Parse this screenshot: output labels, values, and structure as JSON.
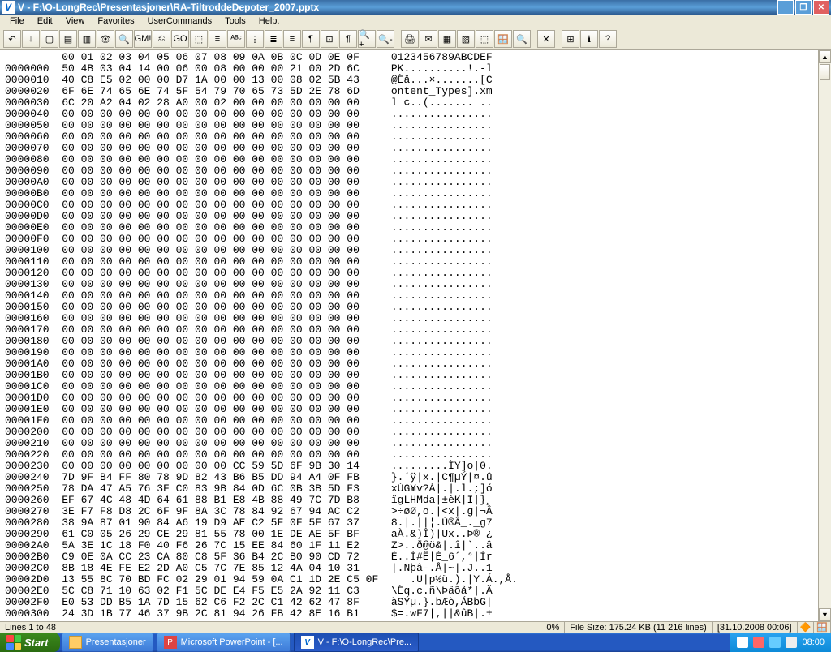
{
  "window": {
    "title": "V - F:\\O-LongRec\\Presentasjoner\\RA-TiltroddeDepoter_2007.pptx"
  },
  "menu": {
    "items": [
      "File",
      "Edit",
      "View",
      "Favorites",
      "UserCommands",
      "Tools",
      "Help."
    ]
  },
  "hex": {
    "header": "         00 01 02 03 04 05 06 07 08 09 0A 0B 0C 0D 0E 0F     0123456789ABCDEF",
    "lines": [
      "0000000  50 4B 03 04 14 00 06 00 08 00 00 00 21 00 2D 6C     PK..........!.-l",
      "0000010  40 C8 E5 02 00 00 D7 1A 00 00 13 00 08 02 5B 43     @Èå...×.......[C",
      "0000020  6F 6E 74 65 6E 74 5F 54 79 70 65 73 5D 2E 78 6D     ontent_Types].xm",
      "0000030  6C 20 A2 04 02 28 A0 00 02 00 00 00 00 00 00 00     l ¢..(....... ..",
      "0000040  00 00 00 00 00 00 00 00 00 00 00 00 00 00 00 00     ................",
      "0000050  00 00 00 00 00 00 00 00 00 00 00 00 00 00 00 00     ................",
      "0000060  00 00 00 00 00 00 00 00 00 00 00 00 00 00 00 00     ................",
      "0000070  00 00 00 00 00 00 00 00 00 00 00 00 00 00 00 00     ................",
      "0000080  00 00 00 00 00 00 00 00 00 00 00 00 00 00 00 00     ................",
      "0000090  00 00 00 00 00 00 00 00 00 00 00 00 00 00 00 00     ................",
      "00000A0  00 00 00 00 00 00 00 00 00 00 00 00 00 00 00 00     ................",
      "00000B0  00 00 00 00 00 00 00 00 00 00 00 00 00 00 00 00     ................",
      "00000C0  00 00 00 00 00 00 00 00 00 00 00 00 00 00 00 00     ................",
      "00000D0  00 00 00 00 00 00 00 00 00 00 00 00 00 00 00 00     ................",
      "00000E0  00 00 00 00 00 00 00 00 00 00 00 00 00 00 00 00     ................",
      "00000F0  00 00 00 00 00 00 00 00 00 00 00 00 00 00 00 00     ................",
      "0000100  00 00 00 00 00 00 00 00 00 00 00 00 00 00 00 00     ................",
      "0000110  00 00 00 00 00 00 00 00 00 00 00 00 00 00 00 00     ................",
      "0000120  00 00 00 00 00 00 00 00 00 00 00 00 00 00 00 00     ................",
      "0000130  00 00 00 00 00 00 00 00 00 00 00 00 00 00 00 00     ................",
      "0000140  00 00 00 00 00 00 00 00 00 00 00 00 00 00 00 00     ................",
      "0000150  00 00 00 00 00 00 00 00 00 00 00 00 00 00 00 00     ................",
      "0000160  00 00 00 00 00 00 00 00 00 00 00 00 00 00 00 00     ................",
      "0000170  00 00 00 00 00 00 00 00 00 00 00 00 00 00 00 00     ................",
      "0000180  00 00 00 00 00 00 00 00 00 00 00 00 00 00 00 00     ................",
      "0000190  00 00 00 00 00 00 00 00 00 00 00 00 00 00 00 00     ................",
      "00001A0  00 00 00 00 00 00 00 00 00 00 00 00 00 00 00 00     ................",
      "00001B0  00 00 00 00 00 00 00 00 00 00 00 00 00 00 00 00     ................",
      "00001C0  00 00 00 00 00 00 00 00 00 00 00 00 00 00 00 00     ................",
      "00001D0  00 00 00 00 00 00 00 00 00 00 00 00 00 00 00 00     ................",
      "00001E0  00 00 00 00 00 00 00 00 00 00 00 00 00 00 00 00     ................",
      "00001F0  00 00 00 00 00 00 00 00 00 00 00 00 00 00 00 00     ................",
      "0000200  00 00 00 00 00 00 00 00 00 00 00 00 00 00 00 00     ................",
      "0000210  00 00 00 00 00 00 00 00 00 00 00 00 00 00 00 00     ................",
      "0000220  00 00 00 00 00 00 00 00 00 00 00 00 00 00 00 00     ................",
      "0000230  00 00 00 00 00 00 00 00 00 CC 59 5D 6F 9B 30 14     .........ÌY]o|0.",
      "0000240  7D 9F B4 FF 80 78 9D 82 43 B6 B5 DD 94 A4 0F FB     }.´ÿ|x.|C¶µÝ|¤.û",
      "0000250  78 DA 47 A5 76 3F C0 83 9B 84 0D 6C 0B 3B 5D F3     xÚG¥v?À|.|.l.;]ó",
      "0000260  EF 67 4C 48 4D 64 61 88 B1 E8 4B 88 49 7C 7D B8     ïgLHMda|±èK|I|}¸",
      "0000270  3E F7 F8 D8 2C 6F 9F 8A 3C 78 84 92 67 94 AC C2     >÷øØ,o.|<x|.g|¬Â",
      "0000280  38 9A 87 01 90 84 A6 19 D9 AE C2 5F 0F 5F 67 37     8.|.||¦.Ù®Â_._g7",
      "0000290  61 C0 05 26 29 CE 29 81 55 78 00 1E DE AE 5F BF     aÀ.&)Î)|Ux..Þ®_¿",
      "00002A0  5A 3E 1C 18 F0 40 F6 26 7C 15 EE 84 60 1F 11 E2     Z>..ð@ö&|.î|`..â",
      "00002B0  C9 0E 0A CC 23 CA 80 C8 5F 36 B4 2C B0 90 CD 72     É..Ì#Ê|È_6´,°|Ír",
      "00002C0  8B 18 4E FE E2 2D A0 C5 7C 7E 85 12 4A 04 10 31     |.Nþâ-.Å|~|.J..1",
      "00002D0  13 55 8C 70 BD FC 02 29 01 94 59 0A C1 1D 2E C5 0F     .U|p½ü.).|Y.Á.,Å.",
      "00002E0  5C C8 71 10 63 02 F1 5C DE E4 F5 E5 2A 92 11 C3     \\Èq.c.ñ\\Þäõå*|.Ã",
      "00002F0  E0 53 DD B5 1A 7D 15 62 C6 F2 2C C1 42 62 47 8F     àSÝµ.}.bÆò,ÁBbG|",
      "0000300  24 3D 1B 77 46 37 9B 2C 81 94 26 FB 42 8E 16 B1     $=.wF7|,||&ûB|.±"
    ]
  },
  "status": {
    "lines": "Lines 1 to 48",
    "percent": "0%",
    "filesize": "File Size: 175.24 KB  (11 216 lines)",
    "datetime": "[31.10.2008  00:06]"
  },
  "taskbar": {
    "start": "Start",
    "tasks": [
      {
        "label": "Presentasjoner",
        "icon": "folder"
      },
      {
        "label": "Microsoft PowerPoint - [...",
        "icon": "ppt"
      },
      {
        "label": "V - F:\\O-LongRec\\Pre...",
        "icon": "v",
        "active": true
      }
    ],
    "clock": "08:00"
  },
  "toolbar_icons": [
    "↶",
    "↓",
    "▢",
    "▤",
    "▥",
    "👁",
    "🔍",
    "GM!",
    "⎌",
    "GO",
    "⬚",
    "≡",
    "ᴬᴮᶜ",
    "⋮",
    "≣",
    "≡",
    "¶",
    "⊡",
    "¶",
    "🔍+",
    "🔍-",
    "",
    "🖨",
    "✉",
    "▦",
    "▧",
    "⬚",
    "🪟",
    "🔍",
    "",
    "✕",
    "",
    "⊞",
    "ℹ",
    "?"
  ]
}
